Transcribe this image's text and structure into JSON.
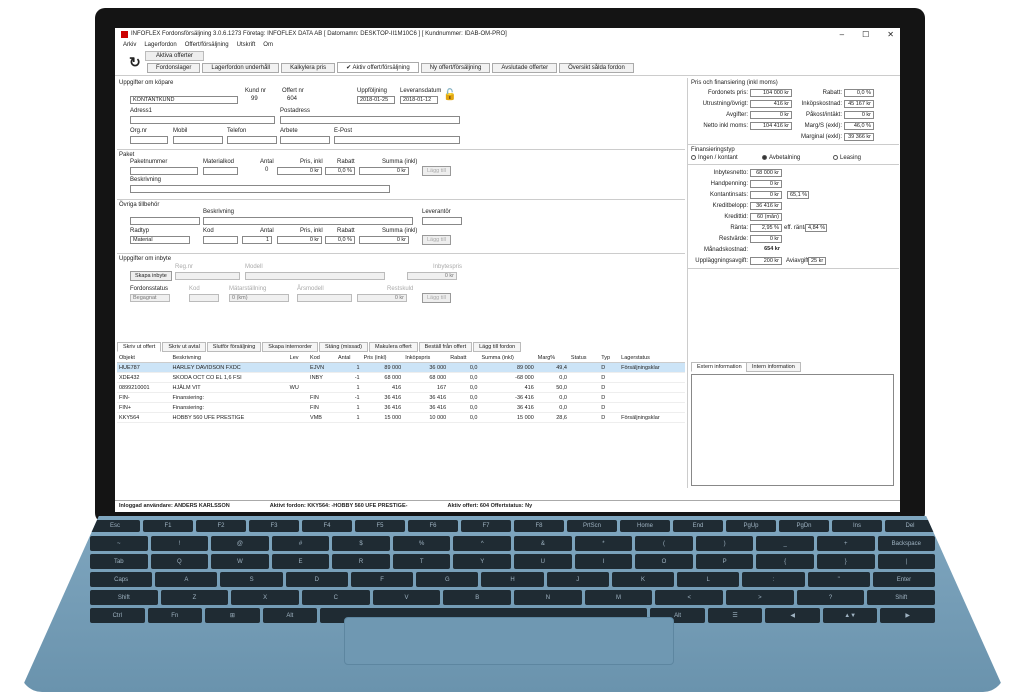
{
  "window": {
    "title": "INFOFLEX Fordonsförsäljning 3.0.6.1273 Företag: INFOFLEX DATA AB   [ Datornamn: DESKTOP-II1M10C6 ]   [ Kundnummer: IDAB-OM-PRO]",
    "min": "–",
    "max": "☐",
    "close": "✕"
  },
  "menu": [
    "Arkiv",
    "Lagerfordon",
    "Offert/försäljning",
    "Utskrift",
    "Om"
  ],
  "toolbar": {
    "active_label": "Aktiva offerter",
    "buttons": [
      "Fordonslager",
      "Lagerfordon underhåll",
      "Kalkylera pris",
      "✔ Aktiv offert/försäljning",
      "Ny offert/försäljning",
      "Avslutade offerter",
      "Översikt sålda fordon"
    ]
  },
  "kund": {
    "header": "Uppgifter om köpare",
    "kundnr_label": "Kund nr",
    "kundnr": "99",
    "offertnr_label": "Offert nr",
    "offertnr": "604",
    "uppfoljning_label": "Uppföljning",
    "uppfoljning": "2018-01-25",
    "leverans_label": "Leveransdatum",
    "leverans": "2018-01-12",
    "name": "KONTANTKUND",
    "adress1": "Adress1",
    "postadress": "Postadress",
    "orgnr": "Org.nr",
    "mobil": "Mobil",
    "telefon": "Telefon",
    "arbete": "Arbete",
    "epost": "E-Post"
  },
  "paket": {
    "header": "Paket",
    "paketnummer": "Paketnummer",
    "materialkod": "Materialkod",
    "antal": "Antal",
    "antal_val": "0",
    "pris": "Pris, inkl",
    "pris_val": "0 kr",
    "rabatt": "Rabatt",
    "rabatt_val": "0,0 %",
    "summa": "Summa (inkl)",
    "summa_val": "0 kr",
    "add": "Lägg till",
    "beskrivning": "Beskrivning"
  },
  "ovriga": {
    "header": "Övriga tillbehör",
    "beskrivning": "Beskrivning",
    "leverantor": "Leverantör",
    "radtyp": "Radtyp",
    "radtyp_val": "Material",
    "kod": "Kod",
    "antal": "Antal",
    "antal_val": "1",
    "pris": "Pris, inkl",
    "pris_val": "0 kr",
    "rabatt": "Rabatt",
    "rabatt_val": "0,0 %",
    "summa": "Summa (inkl)",
    "summa_val": "0 kr",
    "add": "Lägg till"
  },
  "inbyte": {
    "header": "Uppgifter om inbyte",
    "regnr": "Reg.nr",
    "modell": "Modell",
    "pris": "Inbytespris",
    "pris_val": "0 kr",
    "skapa": "Skapa inbyte",
    "fordonstatus": "Fordonsstatus",
    "status_val": "Begagnat",
    "kod": "Kod",
    "mstallning": "Mätarställning",
    "mst_val": "0 (km)",
    "arsmodell": "Årsmodell",
    "restskuld": "Restskuld",
    "rest_val": "0 kr",
    "add": "Lägg till"
  },
  "tabs": [
    "Skriv ut offert",
    "Skriv ut avtal",
    "Slutför försäljning",
    "Skapa internorder",
    "Stäng (missad)",
    "Makulera offert",
    "Beställ från offert",
    "Lägg till fordon"
  ],
  "table": {
    "headers": [
      "Objekt",
      "Beskrivning",
      "Lev",
      "Kod",
      "Antal",
      "Pris (inkl)",
      "Inköpspris",
      "Rabatt",
      "Summa (inkl)",
      "Marg%",
      "Status",
      "Typ",
      "Lagerstatus"
    ],
    "rows": [
      [
        "HUE787",
        "HARLEY DAVIDSON FXDC",
        "",
        "EJVN",
        "1",
        "89 000",
        "36 000",
        "0,0",
        "89 000",
        "49,4",
        "",
        "D",
        "Försäljningsklar"
      ],
      [
        "XDE432",
        "SKODA OCT CO EL 1,6 FSI",
        "",
        "INBY",
        "-1",
        "68 000",
        "68 000",
        "0,0",
        "-68 000",
        "0,0",
        "",
        "D",
        ""
      ],
      [
        "0899210001",
        "HJÄLM VIT",
        "WU",
        "",
        "1",
        "416",
        "167",
        "0,0",
        "416",
        "50,0",
        "",
        "D",
        ""
      ],
      [
        "FIN-",
        "Finansiering:",
        "",
        "FIN",
        "-1",
        "36 416",
        "36 416",
        "0,0",
        "-36 416",
        "0,0",
        "",
        "D",
        ""
      ],
      [
        "FIN+",
        "Finansiering:",
        "",
        "FIN",
        "1",
        "36 416",
        "36 416",
        "0,0",
        "36 416",
        "0,0",
        "",
        "D",
        ""
      ],
      [
        "KKY564",
        "HOBBY 560 UFE PRESTIGE",
        "",
        "VMB",
        "1",
        "15 000",
        "10 000",
        "0,0",
        "15 000",
        "28,6",
        "",
        "D",
        "Försäljningsklar"
      ]
    ]
  },
  "pris": {
    "header": "Pris och finansiering (inkl moms)",
    "fordonets_pris": "Fordonets pris:",
    "fordonets_pris_val": "104 000 kr",
    "rabatt": "Rabatt:",
    "rabatt_val": "0,0 %",
    "utrustning": "Utrustning/övrigt:",
    "utrustning_val": "416 kr",
    "inkopskostnad": "Inköpskostnad:",
    "inkopskostnad_val": "45 167 kr",
    "avgifter": "Avgifter:",
    "avgifter_val": "0 kr",
    "pakost": "Påkost/intäkt:",
    "pakost_val": "0 kr",
    "netto": "Netto inkl moms:",
    "netto_val": "104 416 kr",
    "marg": "Marg/S (exkl):",
    "marg_val": "46,0 %",
    "marginal": "Marginal (exkl):",
    "marginal_val": "39 366 kr"
  },
  "fin": {
    "header": "Finansieringstyp",
    "ingen": "Ingen / kontant",
    "avbetalning": "Avbetalning",
    "leasing": "Leasing",
    "inbytesnetto": "Inbytesnetto:",
    "inbytesnetto_val": "68 000 kr",
    "handpenning": "Handpenning:",
    "handpenning_val": "0 kr",
    "kontantinsats": "Kontantinsats:",
    "kontantinsats_val": "0 kr",
    "kontant_pct": "65,1 %",
    "kreditbelopp": "Kreditbelopp:",
    "kreditbelopp_val": "36 416 kr",
    "kredittid": "Kredittid:",
    "kredittid_val": "60 (mån)",
    "ranta": "Ränta:",
    "ranta_val": "2,95 %",
    "eff_ranta": "eff. ränta:",
    "eff_ranta_val": "4,84 %",
    "restvarde": "Restvärde:",
    "restvarde_val": "0 kr",
    "manadskostnad": "Månadskostnad:",
    "manadskostnad_val": "654 kr",
    "uppl": "Uppläggningsavgift:",
    "uppl_val": "200 kr",
    "avi": "Aviavgift:",
    "avi_val": "25 kr"
  },
  "info_tabs": [
    "Extern information",
    "Intern information"
  ],
  "status": {
    "user": "Inloggad användare: ANDERS KARLSSON",
    "fordon": "Aktivt fordon: KKY564:  -HOBBY 560 UFE PRESTIGE-",
    "offert": "Aktiv offert: 604 Offertstatus: Ny"
  },
  "keys": {
    "r1": [
      "Esc",
      "F1",
      "F2",
      "F3",
      "F4",
      "F5",
      "F6",
      "F7",
      "F8",
      "PrtScn",
      "Home",
      "End",
      "PgUp",
      "PgDn",
      "Ins",
      "Del"
    ],
    "r2": [
      "~",
      "!",
      "@",
      "#",
      "$",
      "%",
      "^",
      "&",
      "*",
      "(",
      ")",
      "_",
      "+",
      "Backspace"
    ],
    "r3": [
      "Tab",
      "Q",
      "W",
      "E",
      "R",
      "T",
      "Y",
      "U",
      "I",
      "O",
      "P",
      "{",
      "}",
      "|"
    ],
    "r4": [
      "Caps",
      "A",
      "S",
      "D",
      "F",
      "G",
      "H",
      "J",
      "K",
      "L",
      ":",
      "\"",
      "Enter"
    ],
    "r5": [
      "Shift",
      "Z",
      "X",
      "C",
      "V",
      "B",
      "N",
      "M",
      "<",
      ">",
      "?",
      "Shift"
    ],
    "r6": [
      "Ctrl",
      "Fn",
      "⊞",
      "Alt",
      "",
      "Alt",
      "☰",
      "◀",
      "▲▼",
      "▶"
    ]
  }
}
